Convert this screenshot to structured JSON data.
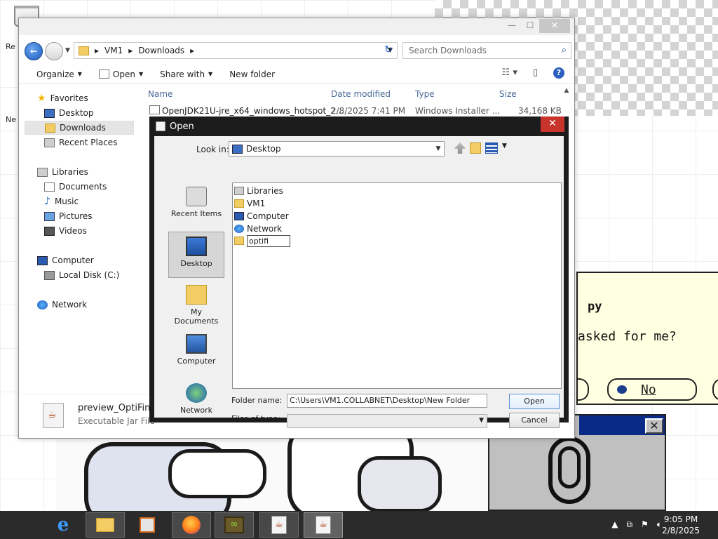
{
  "desktop": {
    "labels": [
      "Re",
      "Ne"
    ],
    "clippy": {
      "title": "py",
      "question": "asked for me?",
      "no_label": "No",
      "close": "✕"
    }
  },
  "explorer": {
    "window_buttons": {
      "minimize": "—",
      "maximize": "☐",
      "close": "✕"
    },
    "breadcrumb": [
      "VM1",
      "Downloads"
    ],
    "search_placeholder": "Search Downloads",
    "toolbar": {
      "organize": "Organize",
      "open": "Open",
      "share_with": "Share with",
      "new_folder": "New folder"
    },
    "nav": {
      "favorites": "Favorites",
      "desktop": "Desktop",
      "downloads": "Downloads",
      "recent_places": "Recent Places",
      "libraries": "Libraries",
      "documents": "Documents",
      "music": "Music",
      "pictures": "Pictures",
      "videos": "Videos",
      "computer": "Computer",
      "local_disk": "Local Disk (C:)",
      "network": "Network"
    },
    "columns": {
      "name": "Name",
      "date": "Date modified",
      "type": "Type",
      "size": "Size"
    },
    "rows": [
      {
        "name": "OpenJDK21U-jre_x64_windows_hotspot_2...",
        "date": "2/8/2025 7:41 PM",
        "type": "Windows Installer ...",
        "size": "34,168 KB"
      }
    ],
    "details": {
      "name": "preview_OptiFine_",
      "type": "Executable Jar File"
    }
  },
  "dialog": {
    "title": "Open",
    "close": "✕",
    "look_in_label": "Look in:",
    "look_in_value": "Desktop",
    "places": {
      "recent": "Recent Items",
      "desktop": "Desktop",
      "documents": "My Documents",
      "computer": "Computer",
      "network": "Network"
    },
    "files": {
      "libraries": "Libraries",
      "vm1": "VM1",
      "computer": "Computer",
      "network": "Network",
      "editing": "optifi"
    },
    "folder_name_label": "Folder name:",
    "folder_name_value": "C:\\Users\\VM1.COLLABNET\\Desktop\\New Folder",
    "files_of_type_label": "Files of type:",
    "open_button": "Open",
    "cancel_button": "Cancel"
  },
  "taskbar": {
    "time": "9:05 PM",
    "date": "2/8/2025",
    "ie_glyph": "e",
    "java_glyph": "☕",
    "mc_glyph": "∞"
  },
  "colors": {
    "taskbar": "#2b2b2b",
    "dialog_frame": "#1c1c1c",
    "close_red": "#c7342c",
    "clippy_bg": "#ffffe1"
  }
}
